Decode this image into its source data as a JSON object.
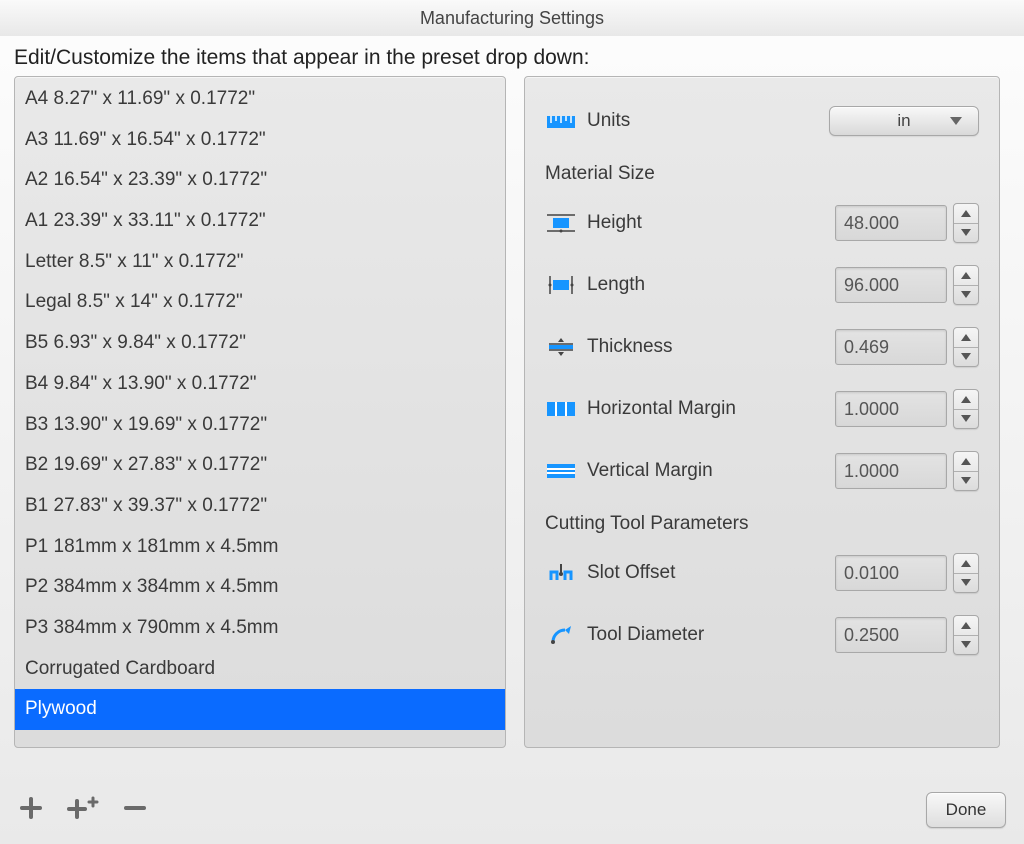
{
  "title": "Manufacturing Settings",
  "subtitle": "Edit/Customize the items that appear in the preset drop down:",
  "presets": [
    {
      "label": "A4 8.27\" x 11.69\" x 0.1772\"",
      "selected": false
    },
    {
      "label": "A3 11.69\" x 16.54\" x 0.1772\"",
      "selected": false
    },
    {
      "label": "A2 16.54\" x 23.39\" x 0.1772\"",
      "selected": false
    },
    {
      "label": "A1 23.39\" x 33.11\" x 0.1772\"",
      "selected": false
    },
    {
      "label": "Letter 8.5\" x 11\" x 0.1772\"",
      "selected": false
    },
    {
      "label": "Legal 8.5\" x 14\" x 0.1772\"",
      "selected": false
    },
    {
      "label": "B5 6.93\" x 9.84\" x 0.1772\"",
      "selected": false
    },
    {
      "label": "B4 9.84\" x 13.90\" x 0.1772\"",
      "selected": false
    },
    {
      "label": "B3 13.90\" x 19.69\" x 0.1772\"",
      "selected": false
    },
    {
      "label": "B2 19.69\" x 27.83\" x 0.1772\"",
      "selected": false
    },
    {
      "label": "B1 27.83\" x 39.37\" x 0.1772\"",
      "selected": false
    },
    {
      "label": "P1 181mm x 181mm x 4.5mm",
      "selected": false
    },
    {
      "label": "P2 384mm x 384mm x 4.5mm",
      "selected": false
    },
    {
      "label": "P3 384mm x 790mm x 4.5mm",
      "selected": false
    },
    {
      "label": "Corrugated Cardboard",
      "selected": false
    },
    {
      "label": "Plywood",
      "selected": true
    }
  ],
  "units": {
    "label": "Units",
    "value": "in"
  },
  "sections": {
    "material": "Material Size",
    "cutting": "Cutting Tool Parameters"
  },
  "fields": {
    "height": {
      "label": "Height",
      "value": "48.000"
    },
    "length": {
      "label": "Length",
      "value": "96.000"
    },
    "thickness": {
      "label": "Thickness",
      "value": "0.469"
    },
    "horizontal_margin": {
      "label": "Horizontal Margin",
      "value": "1.0000"
    },
    "vertical_margin": {
      "label": "Vertical Margin",
      "value": "1.0000"
    },
    "slot_offset": {
      "label": "Slot  Offset",
      "value": "0.0100"
    },
    "tool_diameter": {
      "label": "Tool Diameter",
      "value": "0.2500"
    }
  },
  "buttons": {
    "done": "Done"
  },
  "colors": {
    "selection": "#0a6bff",
    "accent": "#1795ff"
  }
}
